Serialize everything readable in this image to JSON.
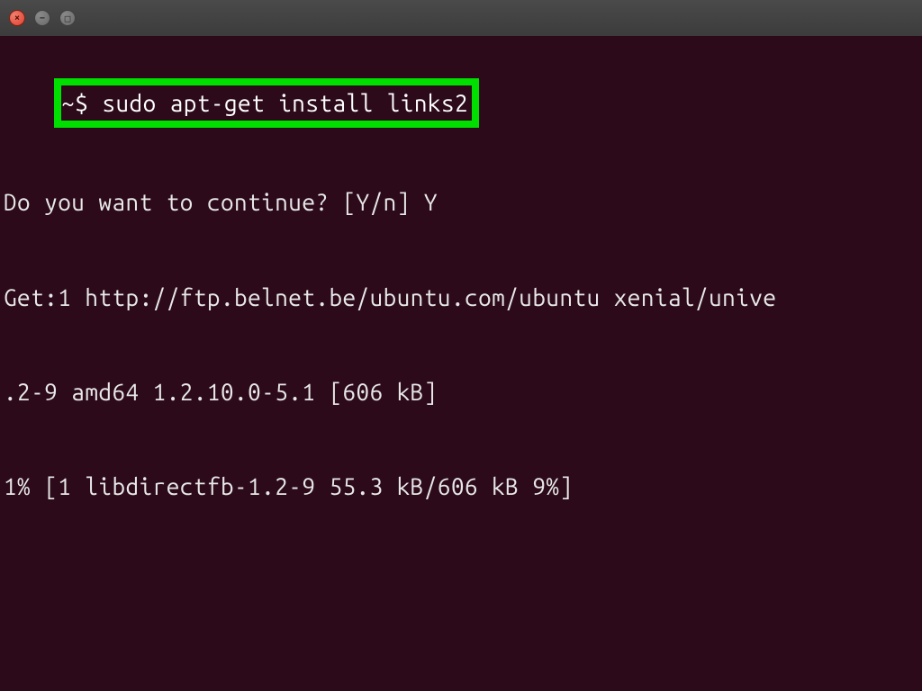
{
  "titlebar": {
    "close_symbol": "×",
    "minimize_symbol": "−",
    "maximize_symbol": "□"
  },
  "terminal": {
    "prompt": "~$ ",
    "command": "sudo apt-get install links2",
    "lines": {
      "l1": "Do you want to continue? [Y/n] Y",
      "l2": "Get:1 http://ftp.belnet.be/ubuntu.com/ubuntu xenial/unive",
      "l3": ".2-9 amd64 1.2.10.0-5.1 [606 kB]",
      "l4": "1% [1 libdirectfb-1.2-9 55.3 kB/606 kB 9%]"
    }
  },
  "colors": {
    "highlight_border": "#00e000",
    "terminal_bg": "#2c0a1a",
    "close_btn": "#e04030"
  }
}
